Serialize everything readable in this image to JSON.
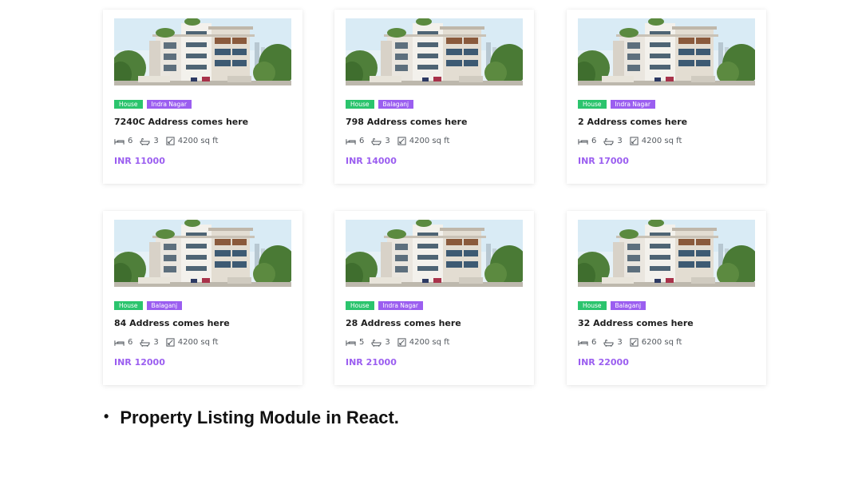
{
  "listings": [
    {
      "type": "House",
      "location": "Indra Nagar",
      "address": "7240C Address comes here",
      "beds": "6",
      "baths": "3",
      "area": "4200 sq ft",
      "price": "INR 11000"
    },
    {
      "type": "House",
      "location": "Balaganj",
      "address": "798 Address comes here",
      "beds": "6",
      "baths": "3",
      "area": "4200 sq ft",
      "price": "INR 14000"
    },
    {
      "type": "House",
      "location": "Indra Nagar",
      "address": "2 Address comes here",
      "beds": "6",
      "baths": "3",
      "area": "4200 sq ft",
      "price": "INR 17000"
    },
    {
      "type": "House",
      "location": "Balaganj",
      "address": "84 Address comes here",
      "beds": "6",
      "baths": "3",
      "area": "4200 sq ft",
      "price": "INR 12000"
    },
    {
      "type": "House",
      "location": "Indra Nagar",
      "address": "28 Address comes here",
      "beds": "5",
      "baths": "3",
      "area": "4200 sq ft",
      "price": "INR 21000"
    },
    {
      "type": "House",
      "location": "Balaganj",
      "address": "32 Address comes here",
      "beds": "6",
      "baths": "3",
      "area": "6200 sq ft",
      "price": "INR 22000"
    }
  ],
  "icons": {
    "beds": "bed-icon",
    "baths": "bathtub-icon",
    "area": "area-icon"
  },
  "colors": {
    "type_tag": "#2bc46d",
    "location_tag": "#9b5ef0",
    "price": "#9b5ef0"
  },
  "caption": {
    "bullet": "•",
    "text": "Property Listing Module in React."
  }
}
